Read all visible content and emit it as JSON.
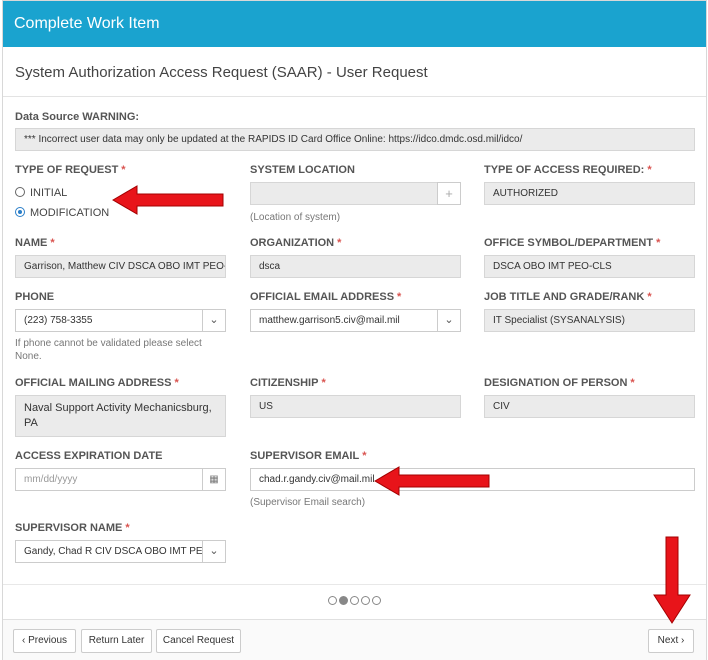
{
  "window_title": "Complete Work Item",
  "form_title": "System Authorization Access Request (SAAR) - User Request",
  "warning": {
    "label": "Data Source WARNING:",
    "text": "*** Incorrect user data may only be updated at the RAPIDS ID Card Office Online: https://idco.dmdc.osd.mil/idco/"
  },
  "type_of_request": {
    "label": "TYPE OF REQUEST",
    "options": [
      "INITIAL",
      "MODIFICATION"
    ],
    "selected": "MODIFICATION"
  },
  "system_location": {
    "label": "SYSTEM LOCATION",
    "value": "",
    "help": "(Location of system)",
    "add_icon": "plus-icon"
  },
  "type_of_access": {
    "label": "TYPE OF ACCESS REQUIRED:",
    "value": "AUTHORIZED"
  },
  "name": {
    "label": "NAME",
    "value": "Garrison, Matthew CIV DSCA OBO IMT PEO-CLS"
  },
  "organization": {
    "label": "ORGANIZATION",
    "value": "dsca"
  },
  "office_symbol": {
    "label": "OFFICE SYMBOL/DEPARTMENT",
    "value": "DSCA OBO IMT PEO-CLS"
  },
  "phone": {
    "label": "PHONE",
    "value": "(223) 758-3355",
    "help": "If phone cannot be validated please select None."
  },
  "official_email": {
    "label": "OFFICIAL EMAIL ADDRESS",
    "value": "matthew.garrison5.civ@mail.mil"
  },
  "job_title": {
    "label": "JOB TITLE AND GRADE/RANK",
    "value": "IT Specialist (SYSANALYSIS)"
  },
  "mailing_address": {
    "label": "OFFICIAL MAILING ADDRESS",
    "value": "Naval Support Activity Mechanicsburg, PA"
  },
  "citizenship": {
    "label": "CITIZENSHIP",
    "value": "US"
  },
  "designation": {
    "label": "DESIGNATION OF PERSON",
    "value": "CIV"
  },
  "access_expiration": {
    "label": "ACCESS EXPIRATION DATE",
    "placeholder": "mm/dd/yyyy",
    "icon": "calendar-icon"
  },
  "supervisor_email": {
    "label": "SUPERVISOR EMAIL",
    "value": "chad.r.gandy.civ@mail.mil",
    "help": "(Supervisor Email search)"
  },
  "supervisor_name": {
    "label": "SUPERVISOR NAME",
    "value": "Gandy, Chad R CIV DSCA OBO IMT PEO-CLS"
  },
  "pagination": {
    "total": 5,
    "current": 2
  },
  "footer": {
    "previous": "Previous",
    "return_later": "Return Later",
    "cancel": "Cancel Request",
    "next": "Next"
  },
  "colors": {
    "header": "#1aa3cf",
    "required": "#d9534f",
    "arrow": "#e8141a",
    "radio": "#2a7ec8"
  }
}
